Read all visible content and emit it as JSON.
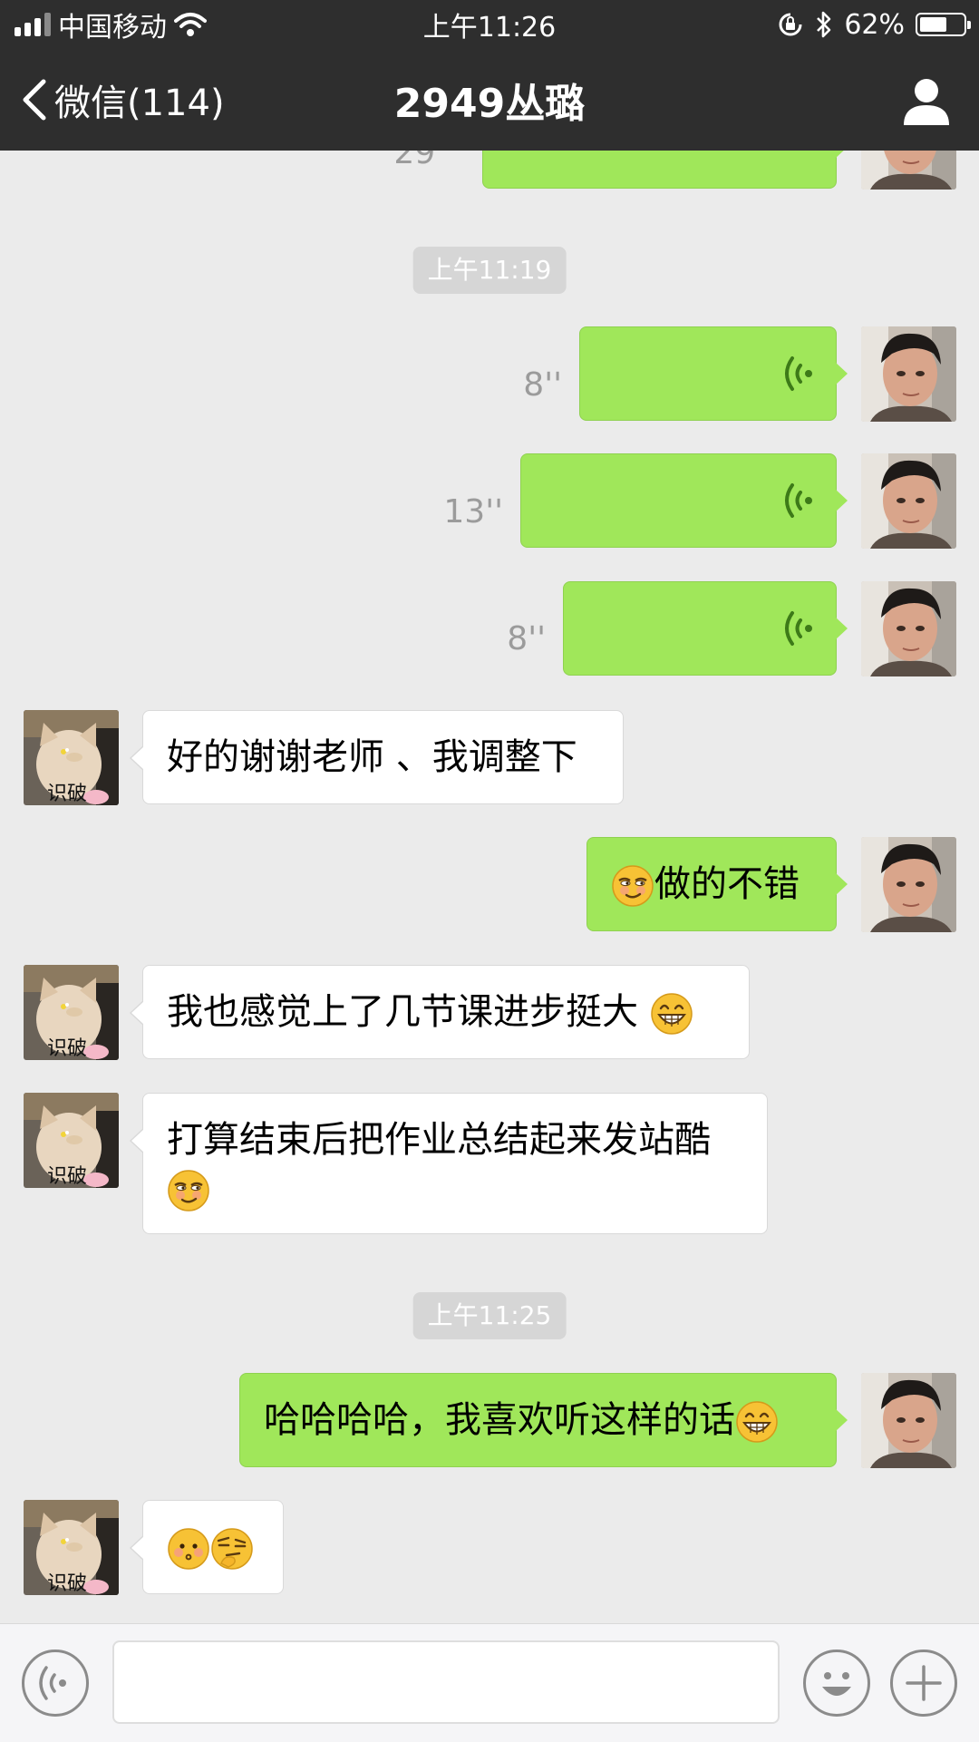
{
  "status_bar": {
    "carrier": "中国移动",
    "time": "上午11:26",
    "battery": "62%",
    "battery_level": 0.62
  },
  "nav": {
    "back_label": "微信(114)",
    "title": "2949丛璐"
  },
  "messages": {
    "top_partial_duration": "29''",
    "time1": "上午11:19",
    "voice1_duration": "8''",
    "voice2_duration": "13''",
    "voice3_duration": "8''",
    "msg1": "好的谢谢老师 、我调整下",
    "msg2": "做的不错",
    "msg3": "我也感觉上了几节课进步挺大 ",
    "msg4": "打算结束后把作业总结起来发站酷",
    "time2": "上午11:25",
    "msg5": "哈哈哈哈，我喜欢听这样的话",
    "avatar_caption": "识破"
  },
  "icons": {
    "back": "chevron-left-icon",
    "profile": "person-icon",
    "voice": "voice-wave-icon",
    "emoji_smirk": "smirk-emoji",
    "emoji_grin": "grin-emoji",
    "emoji_blush": "blush-emoji",
    "emoji_thinking": "thinking-emoji",
    "voice_input": "voice-input-icon",
    "emoji_keyboard": "emoji-icon",
    "more": "plus-icon"
  },
  "colors": {
    "nav_bg": "#2e2e2e",
    "chat_bg": "#ebebeb",
    "sent_bubble": "#a0e75a",
    "received_bubble": "#ffffff"
  }
}
